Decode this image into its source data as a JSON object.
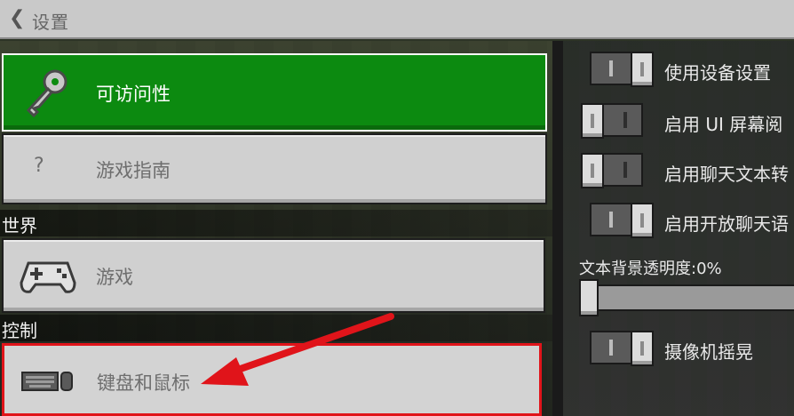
{
  "header": {
    "back_icon": "chevron-left-icon",
    "title": "设置"
  },
  "sidebar": {
    "items": [
      {
        "label": "可访问性",
        "icon": "key-icon",
        "state": "active"
      },
      {
        "label": "游戏指南",
        "icon": "question-icon",
        "state": "normal"
      }
    ],
    "sections": [
      {
        "title": "世界",
        "items": [
          {
            "label": "游戏",
            "icon": "gamepad-icon"
          }
        ]
      },
      {
        "title": "控制",
        "items": [
          {
            "label": "键盘和鼠标",
            "icon": "keyboard-mouse-icon",
            "state": "selected"
          }
        ]
      }
    ]
  },
  "settings": {
    "toggles": [
      {
        "label": "使用设备设置",
        "on": true
      },
      {
        "label": "启用 UI 屏幕阅",
        "on": false
      },
      {
        "label": "启用聊天文本转",
        "on": false
      },
      {
        "label": "启用开放聊天语",
        "on": true
      }
    ],
    "opacity_label": "文本背景透明度:0%",
    "opacity_value": 0,
    "camera_shake": {
      "label": "摄像机摇晃",
      "on": true
    }
  },
  "colors": {
    "active": "#0c8a10",
    "selected_border": "#e0141a",
    "annotation_arrow": "#e0141a"
  }
}
